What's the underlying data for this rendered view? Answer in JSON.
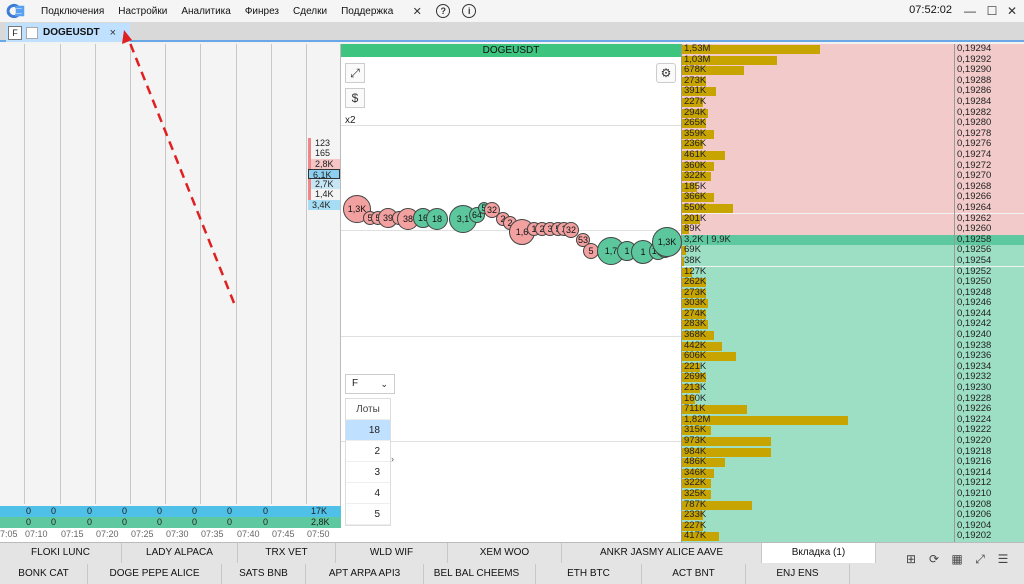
{
  "menu": {
    "items": [
      "Подключения",
      "Настройки",
      "Аналитика",
      "Финрез",
      "Сделки",
      "Поддержка"
    ],
    "clock": "07:52:02"
  },
  "tab": {
    "f_label": "F",
    "label": "DOGEUSDT",
    "close": "×"
  },
  "left": {
    "times": [
      "7:05",
      "07:10",
      "07:15",
      "07:20",
      "07:25",
      "07:30",
      "07:35",
      "07:40",
      "07:45",
      "07:50"
    ],
    "row1": [
      "0",
      "0",
      "0",
      "0",
      "0",
      "0",
      "0",
      "0",
      "17K"
    ],
    "row2": [
      "0",
      "0",
      "0",
      "0",
      "0",
      "0",
      "0",
      "0",
      "2,8K"
    ],
    "ladder": [
      "123",
      "165",
      "2,8K",
      "6,1K",
      "2,7K",
      "1,4K",
      "3,4K"
    ]
  },
  "mid": {
    "title": "DOGEUSDT",
    "x2": "x2",
    "select": "F",
    "lots_header": "Лоты",
    "lots": [
      "18",
      "2",
      "3",
      "4",
      "5"
    ],
    "bubbles": [
      {
        "t": "1,3K",
        "c": "red"
      },
      {
        "t": "5",
        "c": "red"
      },
      {
        "t": "5",
        "c": "red"
      },
      {
        "t": "39",
        "c": "red"
      },
      {
        "t": "1",
        "c": "red"
      },
      {
        "t": "38",
        "c": "red"
      },
      {
        "t": "16",
        "c": "green"
      },
      {
        "t": "18",
        "c": "green"
      },
      {
        "t": "3,1",
        "c": "green"
      },
      {
        "t": "64",
        "c": "green"
      },
      {
        "t": "5",
        "c": "green"
      },
      {
        "t": "32",
        "c": "red"
      },
      {
        "t": "2",
        "c": "red"
      },
      {
        "t": "2",
        "c": "red"
      },
      {
        "t": "1,6",
        "c": "red"
      },
      {
        "t": "1",
        "c": "red"
      },
      {
        "t": "2",
        "c": "red"
      },
      {
        "t": "3",
        "c": "red"
      },
      {
        "t": "5",
        "c": "red"
      },
      {
        "t": "1",
        "c": "red"
      },
      {
        "t": "32",
        "c": "red"
      },
      {
        "t": "53",
        "c": "red"
      },
      {
        "t": "5",
        "c": "red"
      },
      {
        "t": "1,7",
        "c": "green"
      },
      {
        "t": "1",
        "c": "green"
      },
      {
        "t": "1",
        "c": "green"
      },
      {
        "t": "1,3",
        "c": "green"
      },
      {
        "t": "6",
        "c": "green"
      },
      {
        "t": "1,3K",
        "c": "green"
      }
    ]
  },
  "book": {
    "rows": [
      {
        "v": "1,53M",
        "p": "0,19294",
        "s": "ask",
        "f": 0.51
      },
      {
        "v": "1,03M",
        "p": "0,19292",
        "s": "ask",
        "f": 0.35
      },
      {
        "v": "678K",
        "p": "0,19290",
        "s": "ask",
        "f": 0.23
      },
      {
        "v": "273K",
        "p": "0,19288",
        "s": "ask",
        "f": 0.09
      },
      {
        "v": "391K",
        "p": "0,19286",
        "s": "ask",
        "f": 0.13
      },
      {
        "v": "227K",
        "p": "0,19284",
        "s": "ask",
        "f": 0.08
      },
      {
        "v": "294K",
        "p": "0,19282",
        "s": "ask",
        "f": 0.1
      },
      {
        "v": "265K",
        "p": "0,19280",
        "s": "ask",
        "f": 0.09
      },
      {
        "v": "359K",
        "p": "0,19278",
        "s": "ask",
        "f": 0.12
      },
      {
        "v": "236K",
        "p": "0,19276",
        "s": "ask",
        "f": 0.08
      },
      {
        "v": "461K",
        "p": "0,19274",
        "s": "ask",
        "f": 0.16
      },
      {
        "v": "360K",
        "p": "0,19272",
        "s": "ask",
        "f": 0.12
      },
      {
        "v": "322K",
        "p": "0,19270",
        "s": "ask",
        "f": 0.11
      },
      {
        "v": "185K",
        "p": "0,19268",
        "s": "ask",
        "f": 0.06
      },
      {
        "v": "366K",
        "p": "0,19266",
        "s": "ask",
        "f": 0.12
      },
      {
        "v": "550K",
        "p": "0,19264",
        "s": "ask",
        "f": 0.19
      },
      {
        "v": "201K",
        "p": "0,19262",
        "s": "ask",
        "f": 0.07
      },
      {
        "v": "89K",
        "p": "0,19260",
        "s": "ask",
        "f": 0.03
      },
      {
        "v": "3,2K | 9,9K",
        "p": "0,19258",
        "s": "mid",
        "f": 0
      },
      {
        "v": "69K",
        "p": "0,19256",
        "s": "bid",
        "f": 0.02
      },
      {
        "v": "38K",
        "p": "0,19254",
        "s": "bid",
        "f": 0.01
      },
      {
        "v": "127K",
        "p": "0,19252",
        "s": "bid",
        "f": 0.04
      },
      {
        "v": "262K",
        "p": "0,19250",
        "s": "bid",
        "f": 0.09
      },
      {
        "v": "273K",
        "p": "0,19248",
        "s": "bid",
        "f": 0.09
      },
      {
        "v": "303K",
        "p": "0,19246",
        "s": "bid",
        "f": 0.1
      },
      {
        "v": "274K",
        "p": "0,19244",
        "s": "bid",
        "f": 0.09
      },
      {
        "v": "283K",
        "p": "0,19242",
        "s": "bid",
        "f": 0.1
      },
      {
        "v": "368K",
        "p": "0,19240",
        "s": "bid",
        "f": 0.12
      },
      {
        "v": "442K",
        "p": "0,19238",
        "s": "bid",
        "f": 0.15
      },
      {
        "v": "606K",
        "p": "0,19236",
        "s": "bid",
        "f": 0.2
      },
      {
        "v": "221K",
        "p": "0,19234",
        "s": "bid",
        "f": 0.07
      },
      {
        "v": "269K",
        "p": "0,19232",
        "s": "bid",
        "f": 0.09
      },
      {
        "v": "213K",
        "p": "0,19230",
        "s": "bid",
        "f": 0.07
      },
      {
        "v": "160K",
        "p": "0,19228",
        "s": "bid",
        "f": 0.05
      },
      {
        "v": "711K",
        "p": "0,19226",
        "s": "bid",
        "f": 0.24
      },
      {
        "v": "1,82M",
        "p": "0,19224",
        "s": "bid",
        "f": 0.61
      },
      {
        "v": "315K",
        "p": "0,19222",
        "s": "bid",
        "f": 0.11
      },
      {
        "v": "973K",
        "p": "0,19220",
        "s": "bid",
        "f": 0.33
      },
      {
        "v": "984K",
        "p": "0,19218",
        "s": "bid",
        "f": 0.33
      },
      {
        "v": "486K",
        "p": "0,19216",
        "s": "bid",
        "f": 0.16
      },
      {
        "v": "346K",
        "p": "0,19214",
        "s": "bid",
        "f": 0.12
      },
      {
        "v": "322K",
        "p": "0,19212",
        "s": "bid",
        "f": 0.11
      },
      {
        "v": "325K",
        "p": "0,19210",
        "s": "bid",
        "f": 0.11
      },
      {
        "v": "787K",
        "p": "0,19208",
        "s": "bid",
        "f": 0.26
      },
      {
        "v": "233K",
        "p": "0,19206",
        "s": "bid",
        "f": 0.08
      },
      {
        "v": "227K",
        "p": "0,19204",
        "s": "bid",
        "f": 0.08
      },
      {
        "v": "417K",
        "p": "0,19202",
        "s": "bid",
        "f": 0.14
      }
    ]
  },
  "bottom": {
    "row1": [
      "FLOKI LUNC",
      "LADY ALPACA",
      "TRX VET",
      "WLD WIF",
      "XEM WOO",
      "ANKR JASMY ALICE AAVE",
      "Вкладка (1)"
    ],
    "row2": [
      "BONK CAT",
      "DOGE PEPE ALICE",
      "SATS BNB",
      "APT ARPA API3",
      "BEL BAL CHEEMS",
      "ETH BTC",
      "ACT BNT",
      "ENJ ENS"
    ]
  },
  "colors": {
    "accent": "#6aa7e6",
    "header_green": "#3dc47e",
    "ask": "#f2caca",
    "bid": "#9ddfc5",
    "volume_bar": "#c8a400",
    "annotation_arrow": "#e02020"
  }
}
